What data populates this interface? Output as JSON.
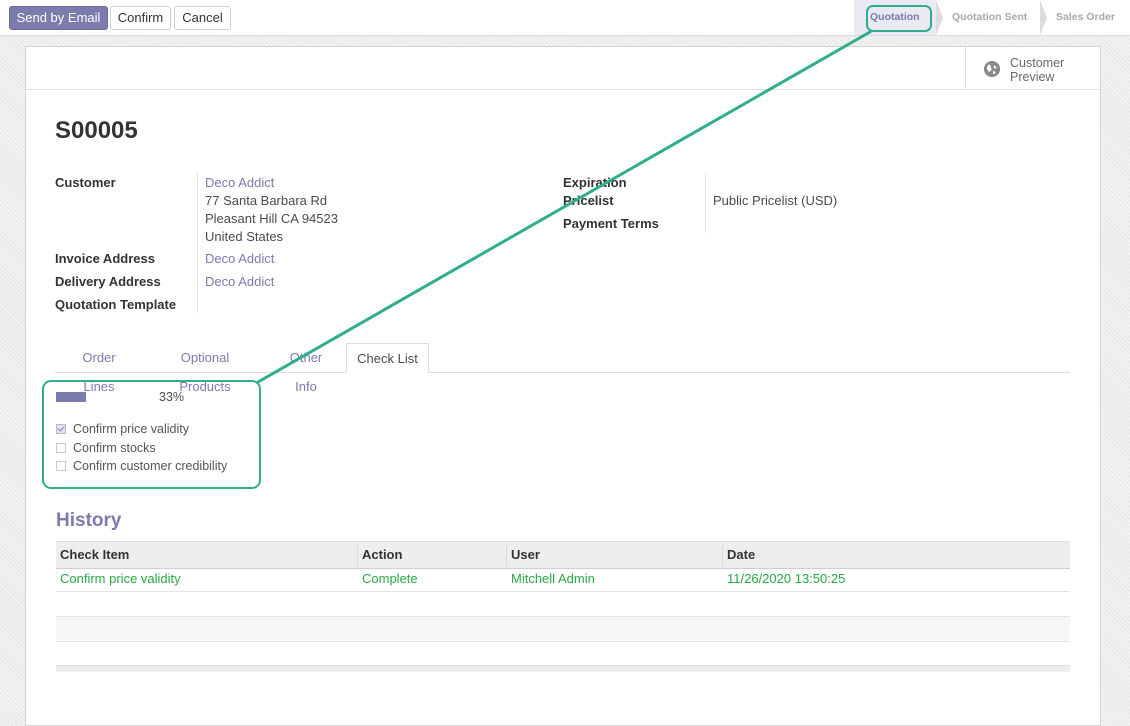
{
  "control": {
    "send_email": "Send by Email",
    "confirm": "Confirm",
    "cancel": "Cancel"
  },
  "statusbar": {
    "stages": [
      "Quotation",
      "Quotation Sent",
      "Sales Order"
    ],
    "active": "Quotation"
  },
  "smart_button": {
    "label_line1": "Customer",
    "label_line2": "Preview",
    "icon": "globe-icon"
  },
  "record": {
    "name": "S00005",
    "customer_label": "Customer",
    "customer_name": "Deco Addict",
    "customer_address": [
      "77 Santa Barbara Rd",
      "Pleasant Hill CA 94523",
      "United States"
    ],
    "invoice_label": "Invoice Address",
    "invoice_value": "Deco Addict",
    "delivery_label": "Delivery Address",
    "delivery_value": "Deco Addict",
    "template_label": "Quotation Template",
    "expiration_label": "Expiration",
    "pricelist_label": "Pricelist",
    "pricelist_value": "Public Pricelist (USD)",
    "payment_terms_label": "Payment Terms"
  },
  "tabs": [
    {
      "label": "Order Lines"
    },
    {
      "label": "Optional Products"
    },
    {
      "label": "Other Info"
    },
    {
      "label": "Check List",
      "active": true
    }
  ],
  "checklist": {
    "progress_percent": 33,
    "progress_text": "33%",
    "items": [
      {
        "label": "Confirm price validity",
        "checked": true
      },
      {
        "label": "Confirm stocks",
        "checked": false
      },
      {
        "label": "Confirm customer credibility",
        "checked": false
      }
    ]
  },
  "history": {
    "title": "History",
    "columns": [
      "Check Item",
      "Action",
      "User",
      "Date"
    ],
    "rows": [
      [
        "Confirm price validity",
        "Complete",
        "Mitchell Admin",
        "11/26/2020 13:50:25"
      ]
    ]
  },
  "colors": {
    "brand": "#7c7bad",
    "success": "#28a745",
    "annotation": "#2fad8c"
  }
}
